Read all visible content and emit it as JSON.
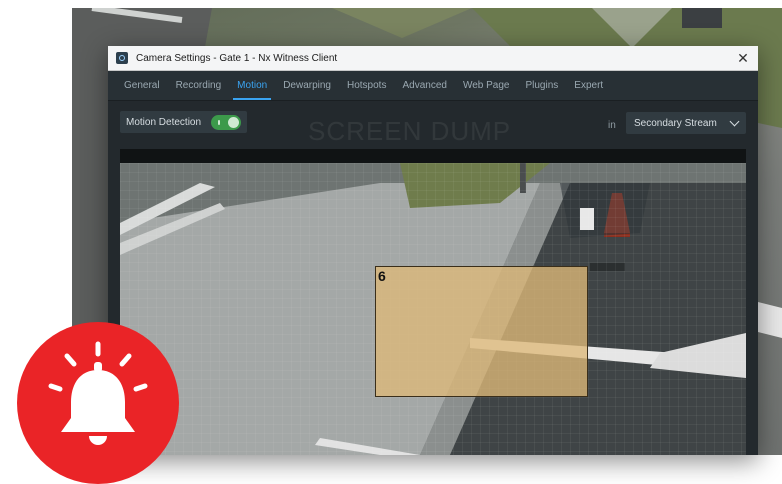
{
  "window": {
    "title": "Camera Settings - Gate 1 - Nx Witness Client",
    "close_glyph": "✕"
  },
  "tabs": [
    {
      "label": "General"
    },
    {
      "label": "Recording"
    },
    {
      "label": "Motion",
      "active": true
    },
    {
      "label": "Dewarping"
    },
    {
      "label": "Hotspots"
    },
    {
      "label": "Advanced"
    },
    {
      "label": "Web Page"
    },
    {
      "label": "Plugins"
    },
    {
      "label": "Expert"
    }
  ],
  "motion": {
    "detection_label": "Motion Detection",
    "detection_enabled": true,
    "in_label": "in",
    "stream_value": "Secondary Stream"
  },
  "watermark": "SCREEN DUMP",
  "region": {
    "label": "6",
    "color": "#deb978"
  },
  "colors": {
    "accent": "#3aa3f0",
    "toggle_on": "#3c9a4b",
    "alarm_red": "#ea2427"
  },
  "icons": {
    "alarm": "bell-icon"
  }
}
